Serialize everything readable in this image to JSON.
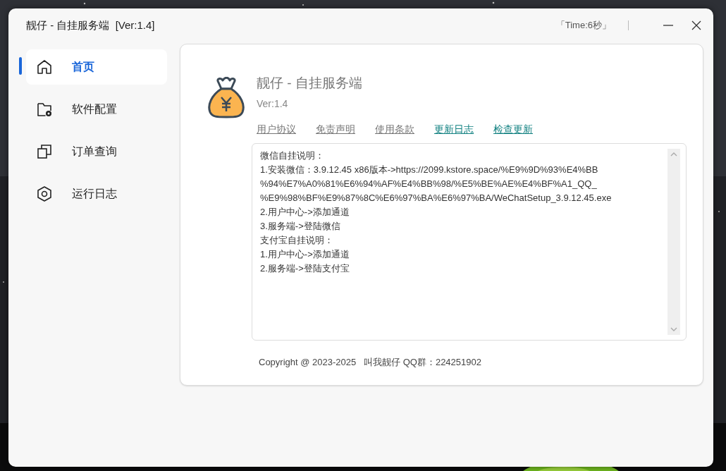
{
  "window": {
    "title": "靓仔 - 自挂服务端  [Ver:1.4]",
    "timer": "「Time:6秒」"
  },
  "sidebar": {
    "items": [
      {
        "label": "首页",
        "selected": true
      },
      {
        "label": "软件配置",
        "selected": false
      },
      {
        "label": "订单查询",
        "selected": false
      },
      {
        "label": "运行日志",
        "selected": false
      }
    ]
  },
  "about": {
    "app_name": "靓仔 - 自挂服务端",
    "version": "Ver:1.4",
    "links": [
      {
        "label": "用户协议",
        "color": "#777777"
      },
      {
        "label": "免责声明",
        "color": "#777777"
      },
      {
        "label": "使用条款",
        "color": "#777777"
      },
      {
        "label": "更新日志",
        "color": "#108080"
      },
      {
        "label": "检查更新",
        "color": "#108080"
      }
    ],
    "notes": [
      "微信自挂说明：",
      "1.安装微信：3.9.12.45 x86版本->https://2099.kstore.space/%E9%9D%93%E4%BB",
      "%94%E7%A0%81%E6%94%AF%E4%BB%98/%E5%BE%AE%E4%BF%A1_QQ_",
      "%E9%98%BF%E9%87%8C%E6%97%BA%E6%97%BA/WeChatSetup_3.9.12.45.exe",
      "2.用户中心->添加通道",
      "3.服务端->登陆微信",
      "支付宝自挂说明：",
      "1.用户中心->添加通道",
      "2.服务端->登陆支付宝"
    ],
    "copyright": "Copyright @ 2023-2025   叫我靓仔 QQ群：224251902"
  }
}
